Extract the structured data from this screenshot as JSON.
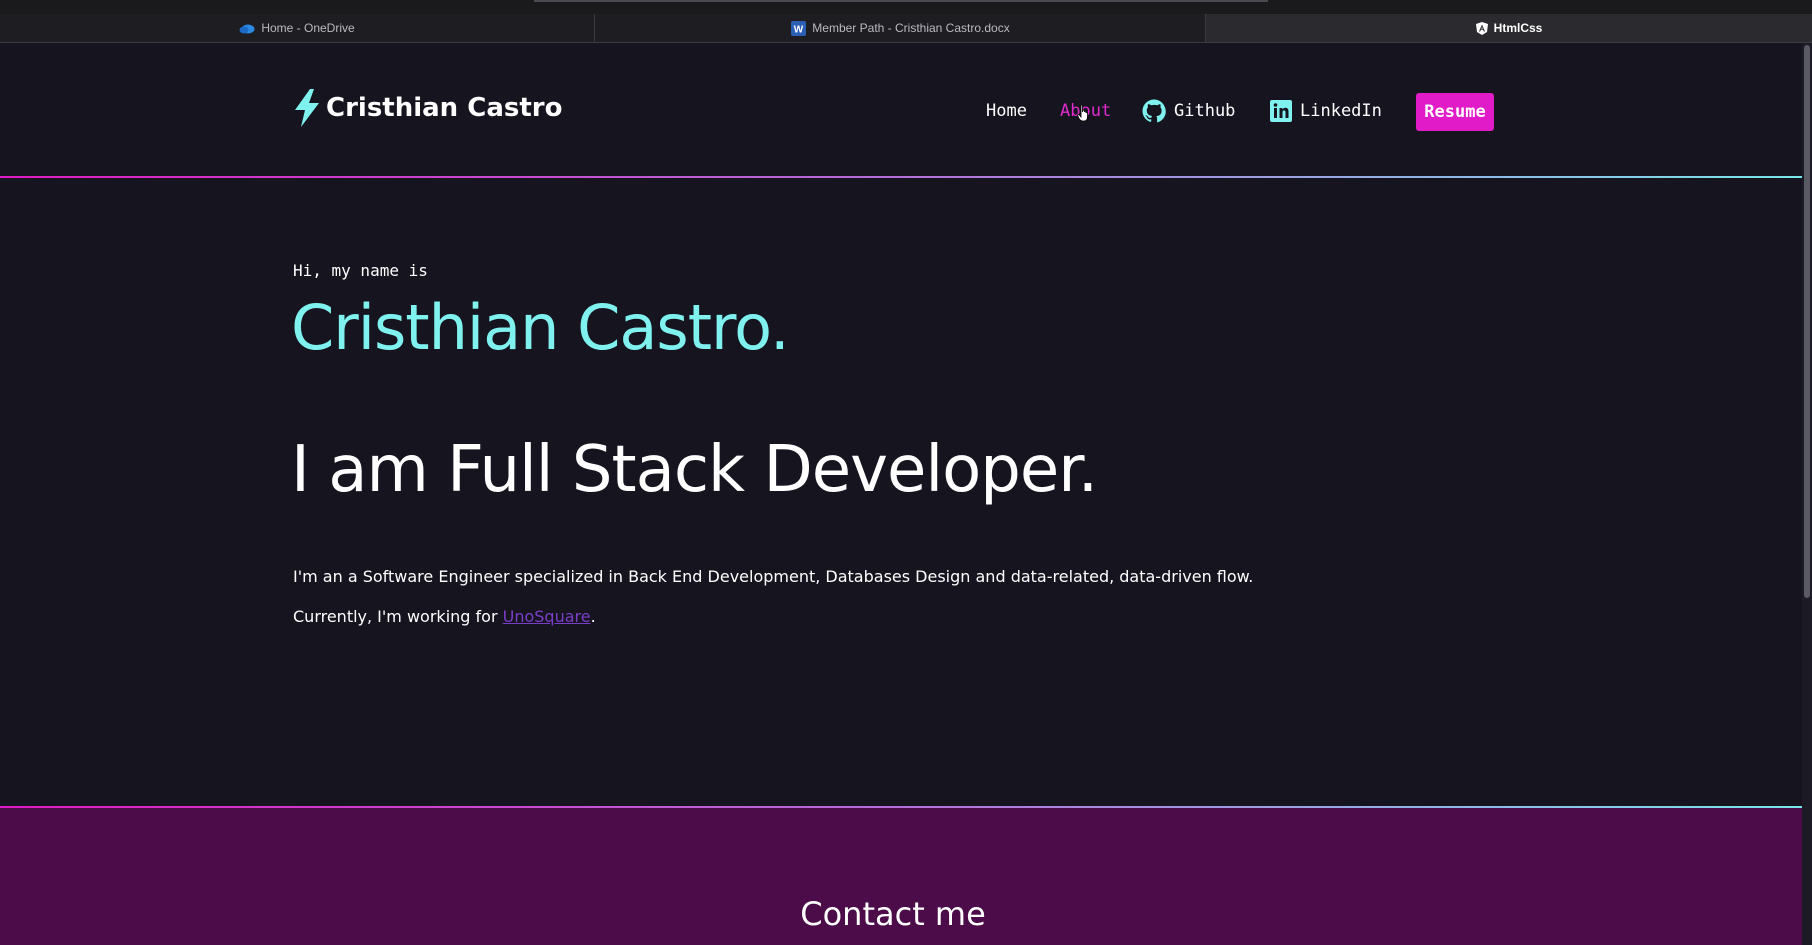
{
  "browser": {
    "tabs": [
      {
        "label": "Home - OneDrive",
        "icon": "onedrive-icon"
      },
      {
        "label": "Member Path - Cristhian Castro.docx",
        "icon": "word-icon"
      },
      {
        "label": "HtmlCss",
        "icon": "angular-icon",
        "active": true
      }
    ]
  },
  "header": {
    "logo_text": "Cristhian Castro",
    "nav": {
      "home": "Home",
      "about": "About",
      "github": "Github",
      "linkedin": "LinkedIn",
      "resume": "Resume"
    }
  },
  "hero": {
    "greeting": "Hi, my name is",
    "name": "Cristhian Castro.",
    "role": "I am Full Stack Developer.",
    "bio": "I'm an a Software Engineer specialized in Back End Development, Databases Design and data-related, data-driven flow.",
    "work_prefix": "Currently, I'm working for ",
    "work_company": "UnoSquare",
    "work_suffix": "."
  },
  "contact": {
    "title": "Contact me"
  },
  "colors": {
    "background": "#15141f",
    "accent_pink": "#e11bc7",
    "accent_cyan": "#7ff1ef",
    "contact_bg": "#4b0c49"
  }
}
